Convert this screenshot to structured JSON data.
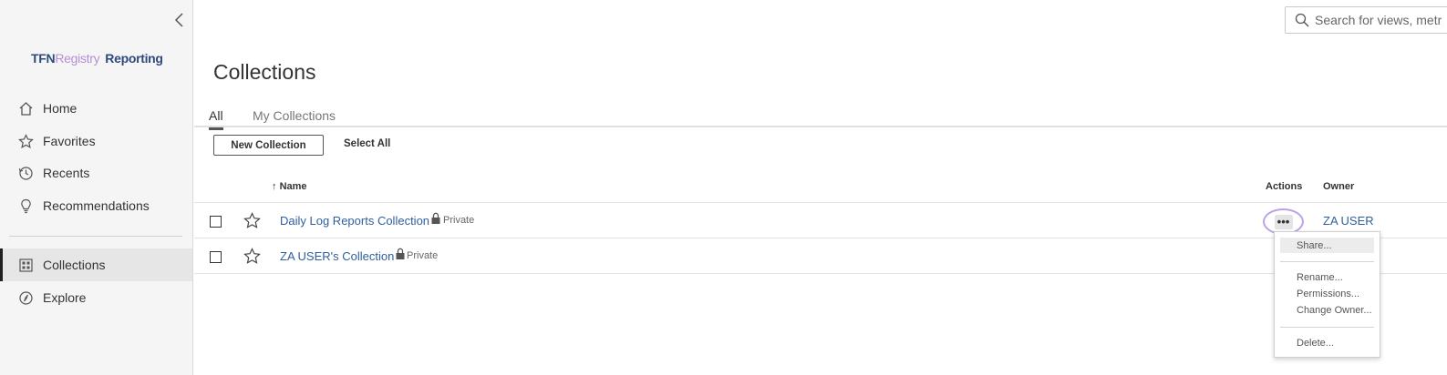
{
  "sidebar": {
    "logo": {
      "part1": "TFN",
      "part2": "Registry",
      "part3": "Reporting"
    },
    "items": [
      {
        "label": "Home",
        "icon": "home-icon"
      },
      {
        "label": "Favorites",
        "icon": "star-icon"
      },
      {
        "label": "Recents",
        "icon": "clock-icon"
      },
      {
        "label": "Recommendations",
        "icon": "lightbulb-icon"
      },
      {
        "label": "Collections",
        "icon": "collections-icon",
        "active": true
      },
      {
        "label": "Explore",
        "icon": "compass-icon"
      }
    ]
  },
  "search": {
    "placeholder": "Search for views, metr"
  },
  "page": {
    "title": "Collections"
  },
  "tabs": [
    {
      "label": "All",
      "active": true
    },
    {
      "label": "My Collections",
      "active": false
    }
  ],
  "toolbar": {
    "new_collection": "New Collection",
    "select_all": "Select All"
  },
  "table": {
    "columns": {
      "sort_arrow": "↑",
      "name": "Name",
      "actions": "Actions",
      "owner": "Owner"
    },
    "rows": [
      {
        "name": "Daily Log Reports Collection",
        "privacy": "Private",
        "owner": "ZA USER"
      },
      {
        "name": "ZA USER's Collection",
        "privacy": "Private",
        "owner": ""
      }
    ]
  },
  "actions_button": {
    "label": "•••"
  },
  "context_menu": {
    "items": [
      "Share...",
      "Rename...",
      "Permissions...",
      "Change Owner...",
      "Delete..."
    ]
  },
  "colors": {
    "link": "#2f5f9e",
    "highlight_ring": "#b9a3e3",
    "logo_primary": "#2e4a7d",
    "logo_accent": "#b48fd6"
  }
}
